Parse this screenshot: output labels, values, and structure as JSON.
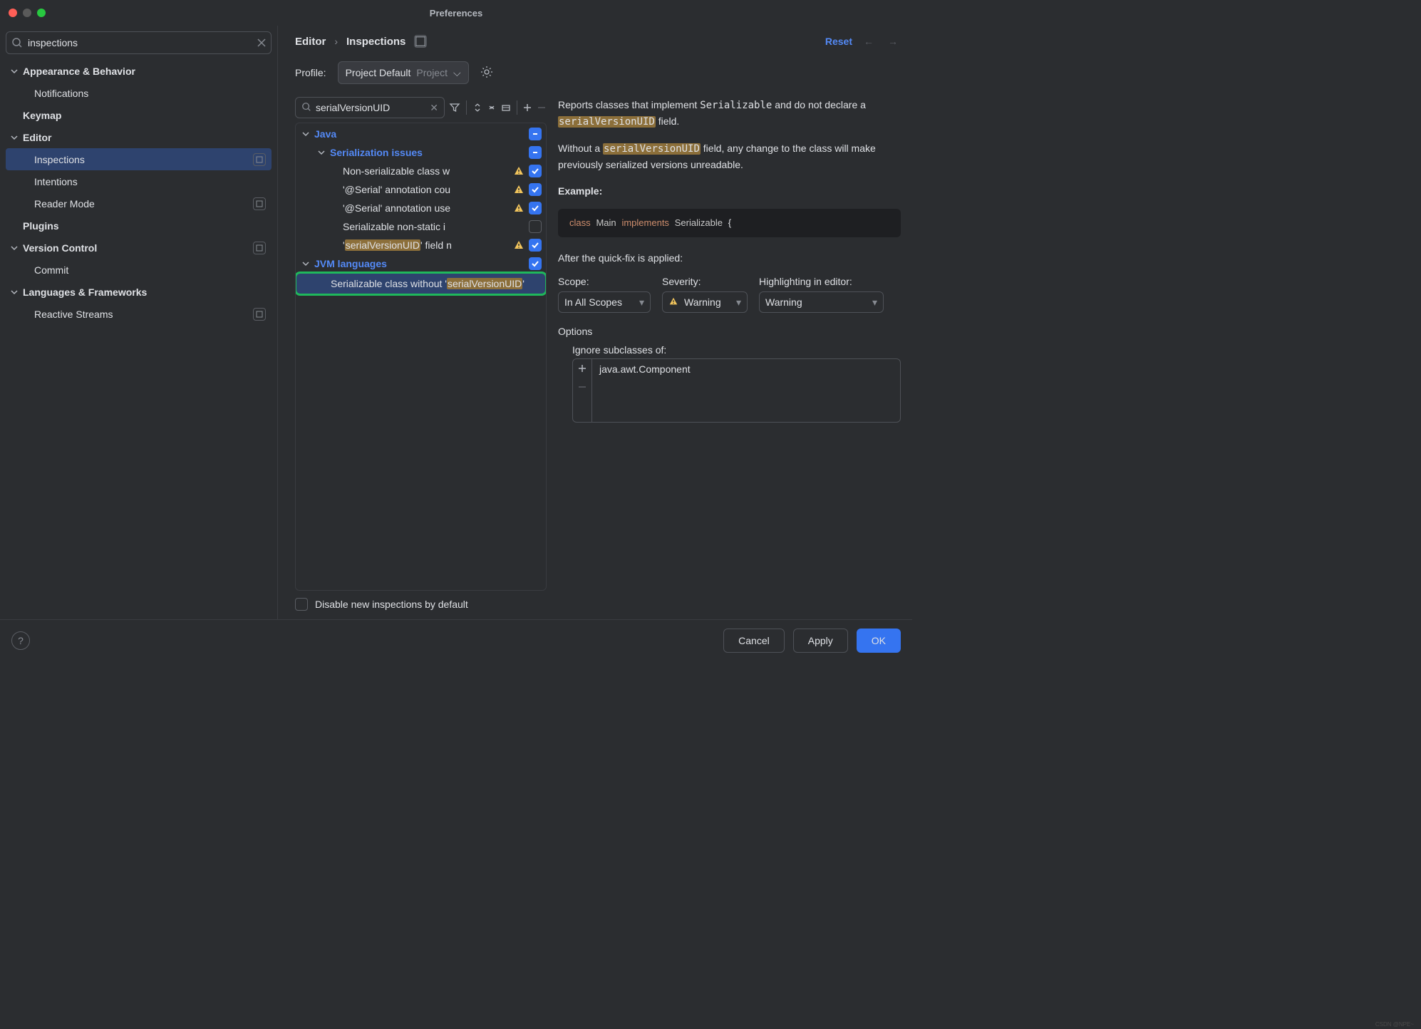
{
  "window": {
    "title": "Preferences"
  },
  "search": {
    "value": "inspections"
  },
  "nav": {
    "items": [
      {
        "label": "Appearance & Behavior",
        "bold": true,
        "chev": true,
        "indent": 0
      },
      {
        "label": "Notifications",
        "indent": 16
      },
      {
        "label": "Keymap",
        "bold": true,
        "indent": 0
      },
      {
        "label": "Editor",
        "bold": true,
        "chev": true,
        "indent": 0
      },
      {
        "label": "Inspections",
        "selected": true,
        "badge": true,
        "indent": 16
      },
      {
        "label": "Intentions",
        "indent": 16
      },
      {
        "label": "Reader Mode",
        "badge": true,
        "indent": 16
      },
      {
        "label": "Plugins",
        "bold": true,
        "indent": 0
      },
      {
        "label": "Version Control",
        "bold": true,
        "chev": true,
        "badge": true,
        "indent": 0
      },
      {
        "label": "Commit",
        "indent": 16
      },
      {
        "label": "Languages & Frameworks",
        "bold": true,
        "chev": true,
        "indent": 0
      },
      {
        "label": "Reactive Streams",
        "badge": true,
        "indent": 16
      }
    ]
  },
  "breadcrumb": {
    "root": "Editor",
    "page": "Inspections",
    "reset": "Reset"
  },
  "profile": {
    "label": "Profile:",
    "value": "Project Default",
    "suffix": "Project"
  },
  "tree_search": {
    "value": "serialVersionUID"
  },
  "tree": {
    "java": "Java",
    "serialization": "Serialization issues",
    "n1_pre": "Non-serializable class w",
    "n2_pre": "'@Serial' annotation cou",
    "n3_pre": "'@Serial' annotation use",
    "n4_pre": "Serializable non-static i",
    "n5_pre": "'",
    "n5_hl": "serialVersionUID",
    "n5_post": "' field n",
    "jvm": "JVM languages",
    "sel_pre": "Serializable class without '",
    "sel_hl": "serialVersionUID",
    "sel_post": "'"
  },
  "desc": {
    "p1a": "Reports classes that implement ",
    "p1code": "Serializable",
    "p1b": " and do not declare a ",
    "p1hl": "serialVersionUID",
    "p1c": " field.",
    "p2a": "Without a ",
    "p2hl": "serialVersionUID",
    "p2b": " field, any change to the class will make previously serialized versions unreadable.",
    "example": "Example:",
    "quickfix": "After the quick-fix is applied:",
    "code_class": "class",
    "code_main": "Main",
    "code_impl": "implements",
    "code_ser": "Serializable",
    "code_brace": "{"
  },
  "scope": {
    "label": "Scope:",
    "value": "In All Scopes"
  },
  "severity": {
    "label": "Severity:",
    "value": "Warning"
  },
  "highlight": {
    "label": "Highlighting in editor:",
    "value": "Warning"
  },
  "options": {
    "title": "Options",
    "subtitle": "Ignore subclasses of:",
    "entry": "java.awt.Component"
  },
  "disable": "Disable new inspections by default",
  "buttons": {
    "cancel": "Cancel",
    "apply": "Apply",
    "ok": "OK"
  },
  "watermark": "CSDN @NPE~"
}
